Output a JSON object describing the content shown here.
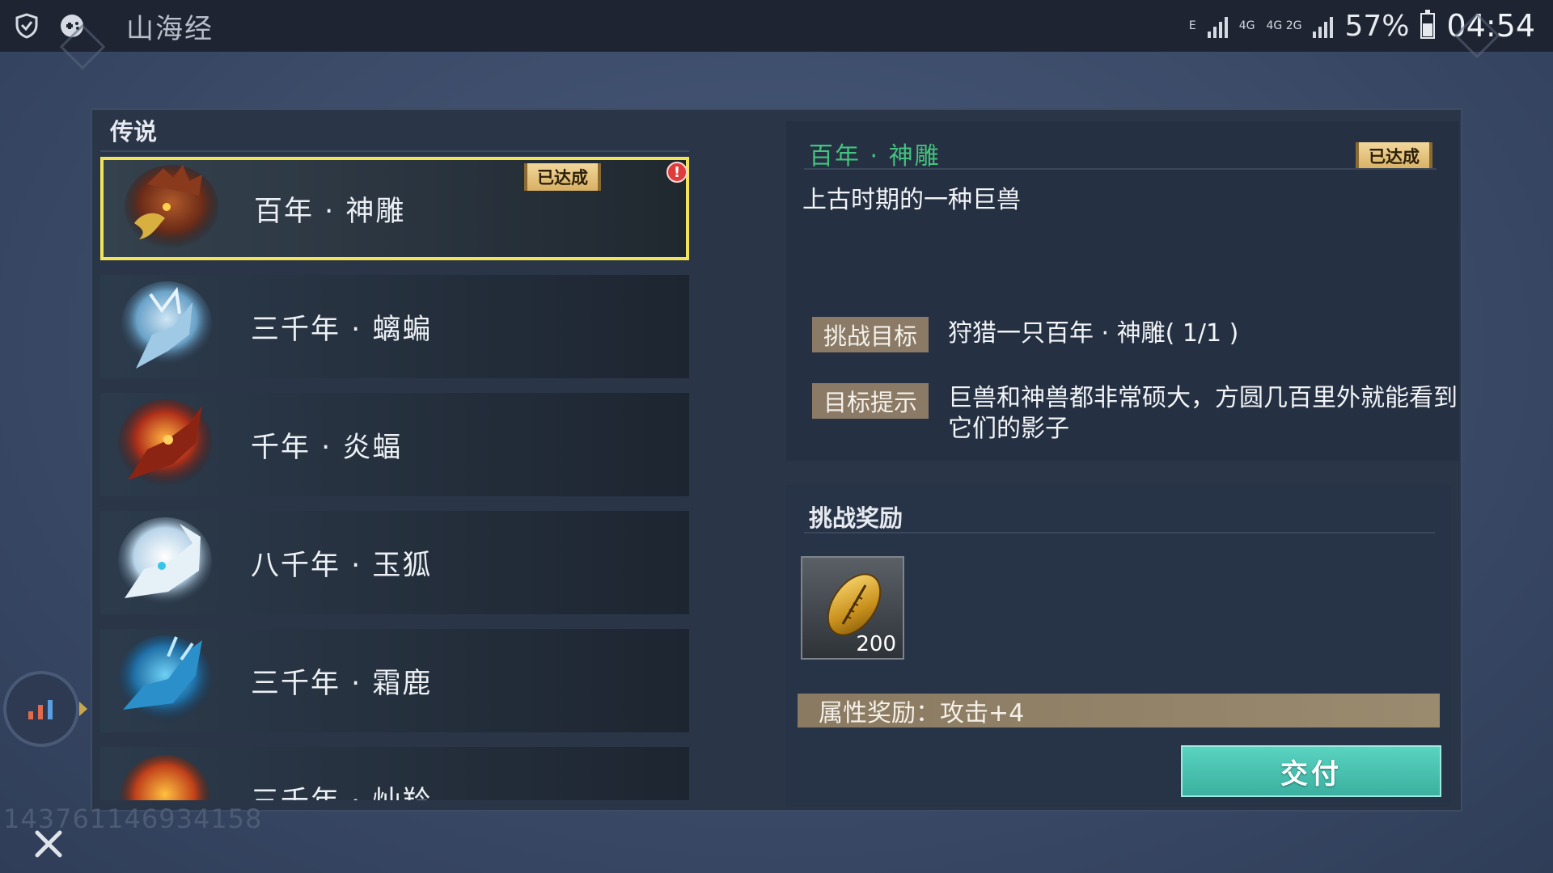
{
  "status_bar": {
    "app_title": "山海经",
    "net_tags": [
      "E",
      "4G",
      "4G 2G"
    ],
    "battery_percent": "57%",
    "battery_level": 0.57,
    "clock": "04:54"
  },
  "list": {
    "header": "传说",
    "items": [
      {
        "name": "百年 · 神雕",
        "badge": "已达成",
        "alert": "!",
        "selected": true,
        "portrait": "eagle-portrait"
      },
      {
        "name": "三千年 · 螭蝙",
        "portrait": "ice-bat-portrait"
      },
      {
        "name": "千年 · 炎蝠",
        "portrait": "fire-bat-portrait"
      },
      {
        "name": "八千年 · 玉狐",
        "portrait": "white-fox-portrait"
      },
      {
        "name": "三千年 · 霜鹿",
        "portrait": "frost-deer-portrait"
      },
      {
        "name": "三千年 · 灿羚",
        "portrait": "flame-beast-portrait"
      }
    ]
  },
  "detail": {
    "title": "百年 · 神雕",
    "badge": "已达成",
    "description": "上古时期的一种巨兽",
    "goal_label": "挑战目标",
    "goal_value": "狩猎一只百年 · 神雕( 1/1 )",
    "hint_label": "目标提示",
    "hint_value": "巨兽和神兽都非常硕大，方圆几百里外就能看到它们的影子"
  },
  "reward": {
    "title": "挑战奖励",
    "item_icon": "gold-shell-icon",
    "item_count": "200",
    "attr_text": "属性奖励：攻击+4",
    "submit_label": "交付"
  },
  "overlay": {
    "user_id": "143761146934158"
  },
  "colors": {
    "highlight": "#f2e35a",
    "title_green": "#43c37d",
    "submit": "#4cc4b2",
    "label_tan": "#8a7a66"
  }
}
